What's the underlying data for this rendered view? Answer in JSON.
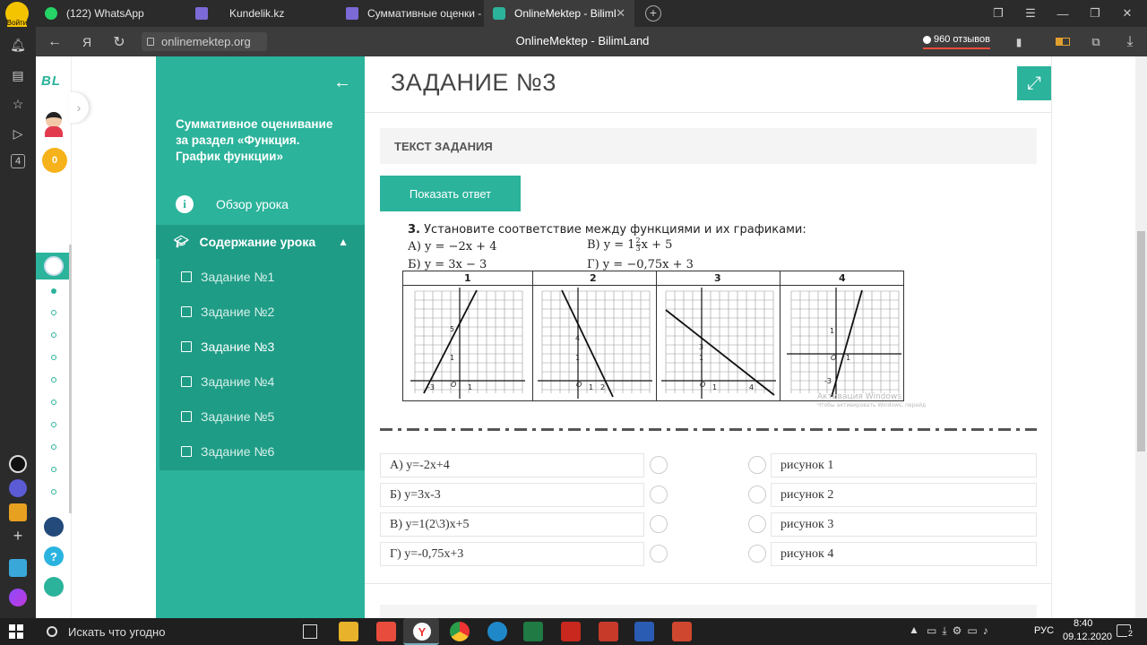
{
  "browser": {
    "login_label": "Войти",
    "tabs": [
      {
        "label": "(122) WhatsApp",
        "color": "#25d366"
      },
      {
        "label": "Kundelik.kz",
        "color": "#7c6ad6"
      },
      {
        "label": "Суммативные оценки - К",
        "color": "#7c6ad6"
      },
      {
        "label": "OnlineMektep - BilimLar",
        "color": "#2bb39b"
      }
    ],
    "url": "onlinemektep.org",
    "page_title": "OnlineMektep - BilimLand",
    "reviews": "960 отзывов",
    "sidebar_badge": "4"
  },
  "rail": {
    "logo": "BL",
    "coins": "0"
  },
  "course": {
    "title": "Суммативное оценивание за раздел «Функция. График функции»",
    "overview": "Обзор урока",
    "contents": "Содержание урока",
    "tasks": [
      "Задание №1",
      "Задание №2",
      "Задание №3",
      "Задание №4",
      "Задание №5",
      "Задание №6"
    ],
    "active_task_index": 2
  },
  "main": {
    "heading": "ЗАДАНИЕ №3",
    "section_label": "ТЕКСТ ЗАДАНИЯ",
    "show_answer": "Показать ответ",
    "question_number": "3.",
    "question": "Установите соответствие между функциями и их графиками:",
    "options_img": {
      "a": "А) y = −2x + 4",
      "b": "Б) y = 3x − 3",
      "v_prefix": "В) y = 1",
      "v_frac_num": "2",
      "v_frac_den": "3",
      "v_suffix": "x + 5",
      "g": "Г) y = −0,75x + 3"
    },
    "graph_headers": [
      "1",
      "2",
      "3",
      "4"
    ],
    "graph_labels": [
      {
        "y": "5",
        "one": "1",
        "x": "-3",
        "o": "O",
        "xone": "1"
      },
      {
        "y": "4",
        "one": "1",
        "o": "O",
        "xone": "1",
        "x2": "2"
      },
      {
        "y": "3",
        "one": "1",
        "o": "O",
        "xone": "1",
        "x4": "4"
      },
      {
        "y": "1",
        "o": "O",
        "xone": "1",
        "neg": "-3"
      }
    ],
    "watermark_line1": "Активация Windows",
    "watermark_line2": "Чтобы активировать Windows, перейд",
    "left_answers": [
      "А) y=-2x+4",
      "Б) y=3x-3",
      "В) y=1(2\\3)x+5",
      "Г) y=-0,75x+3"
    ],
    "right_answers": [
      "рисунок 1",
      "рисунок 2",
      "рисунок 3",
      "рисунок 4"
    ]
  },
  "taskbar": {
    "search": "Искать что угодно",
    "lang": "РУС",
    "time": "8:40",
    "date": "09.12.2020",
    "notif": "2"
  }
}
